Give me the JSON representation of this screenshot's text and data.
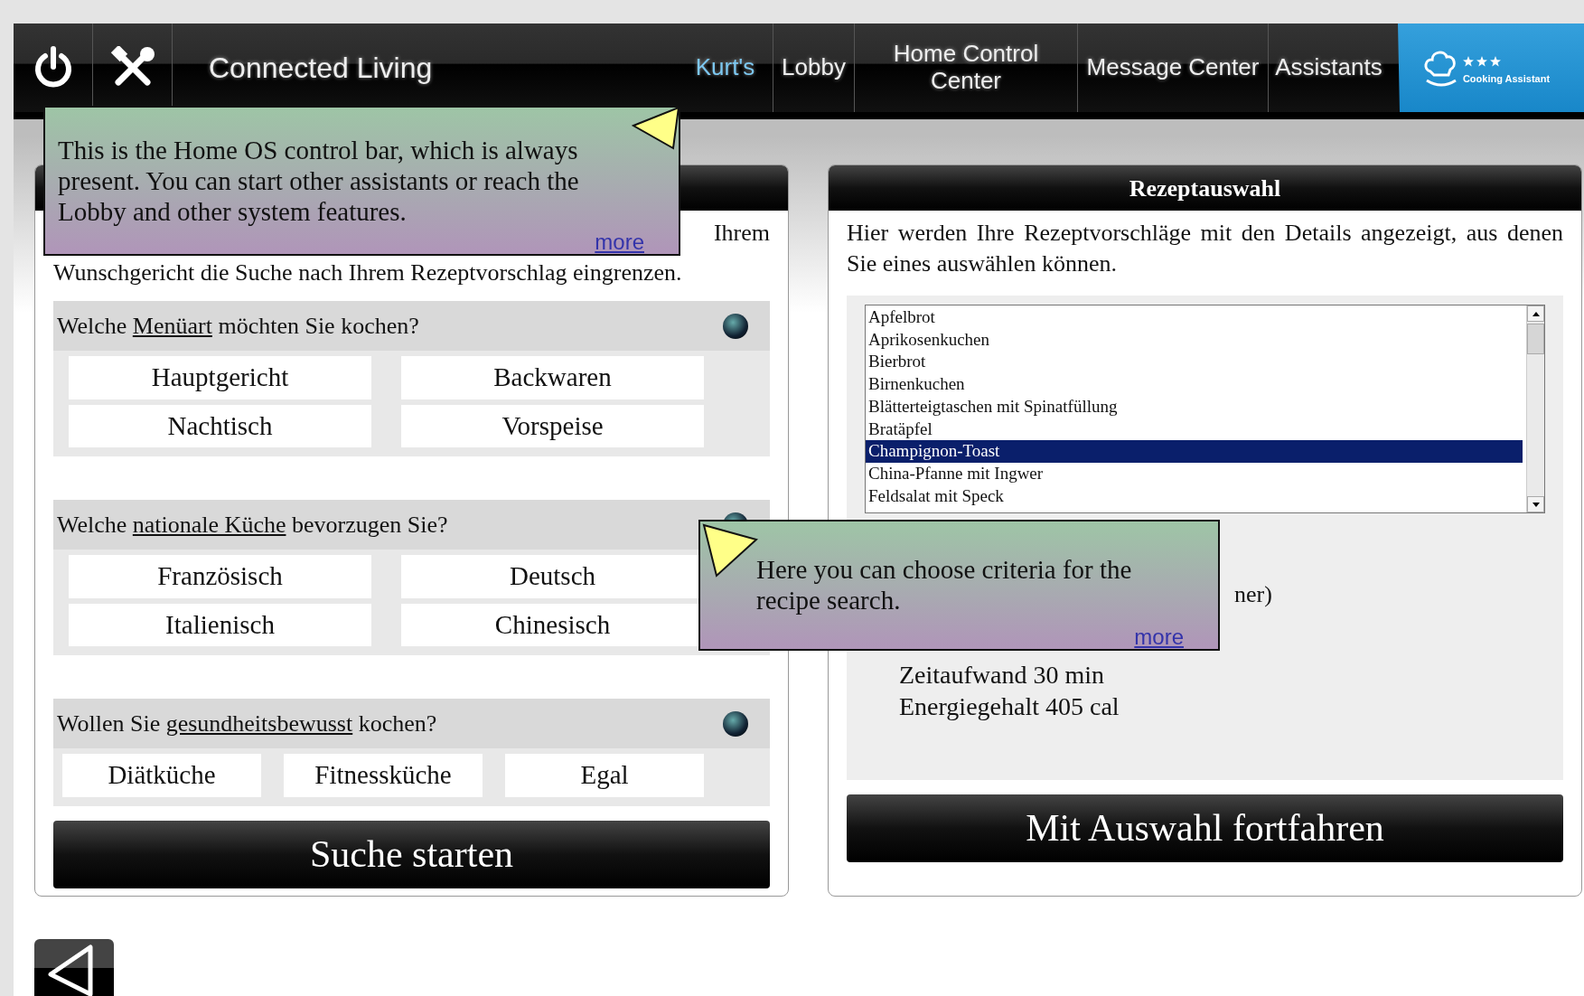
{
  "navbar": {
    "title": "Connected Living",
    "items": [
      {
        "label": "Kurt's",
        "selected": true
      },
      {
        "label": "Lobby",
        "selected": false
      },
      {
        "label": "Home Control Center",
        "selected": false
      },
      {
        "label": "Message Center",
        "selected": false
      },
      {
        "label": "Assistants",
        "selected": false
      }
    ],
    "logo_text": "Cooking Assistant"
  },
  "search_panel": {
    "intro_visible": [
      "Ihrem",
      "Wunschgericht die Suche nach Ihrem Rezeptvorschlag eingrenzen."
    ],
    "questions": [
      {
        "before": "Welche ",
        "term": "Menüart",
        "after": " möchten Sie kochen?",
        "options": [
          "Hauptgericht",
          "Backwaren",
          "Nachtisch",
          "Vorspeise"
        ]
      },
      {
        "before": "Welche ",
        "term": "nationale Küche",
        "after": " bevorzugen Sie?",
        "options": [
          "Französisch",
          "Deutsch",
          "Italienisch",
          "Chinesisch"
        ]
      },
      {
        "before": "Wollen Sie ",
        "term": "gesundheitsbewusst",
        "after": " kochen?",
        "options": [
          "Diätküche",
          "Fitnessküche",
          "Egal"
        ]
      }
    ],
    "button": "Suche starten"
  },
  "recipe_panel": {
    "title": "Rezeptauswahl",
    "intro": "Hier werden Ihre Rezeptvorschläge mit den Details angezeigt, aus denen Sie eines auswählen können.",
    "recipes": [
      {
        "name": "Apfelbrot",
        "selected": false
      },
      {
        "name": "Aprikosenkuchen",
        "selected": false
      },
      {
        "name": "Bierbrot",
        "selected": false
      },
      {
        "name": "Birnenkuchen",
        "selected": false
      },
      {
        "name": "Blätterteigtaschen mit Spinatfüllung",
        "selected": false
      },
      {
        "name": "Bratäpfel",
        "selected": false
      },
      {
        "name": "Champignon-Toast",
        "selected": true
      },
      {
        "name": "China-Pfanne mit Ingwer",
        "selected": false
      },
      {
        "name": "Feldsalat mit Speck",
        "selected": false
      }
    ],
    "details_fragment": "ner)",
    "details": [
      "Zeitaufwand 30 min",
      "Energiegehalt 405 cal"
    ],
    "button": "Mit Auswahl fortfahren"
  },
  "tooltips": [
    {
      "text": "This is the Home OS control bar, which is always present. You can start other assistants or reach the Lobby and other system features.",
      "link": "more"
    },
    {
      "text": "Here you can choose criteria for the recipe search.",
      "link": "more"
    }
  ]
}
